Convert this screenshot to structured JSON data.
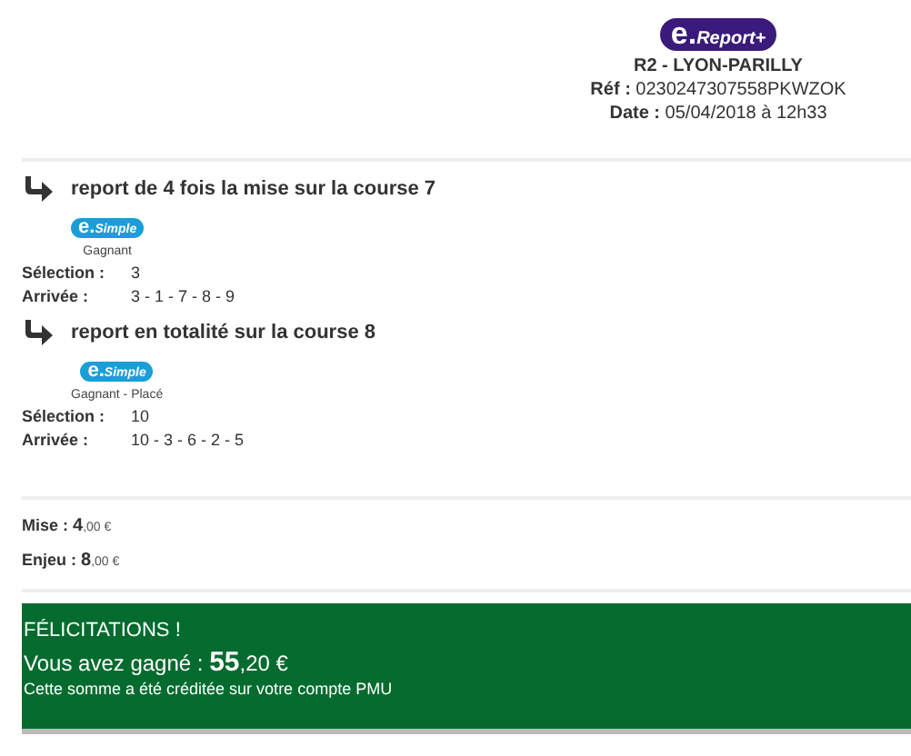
{
  "header": {
    "logo": {
      "mark": "e.",
      "name": "Report+"
    },
    "race": "R2 - LYON-PARILLY",
    "ref_label": "Réf :",
    "ref": "0230247307558PKWZOK",
    "date_label": "Date :",
    "date": "05/04/2018 à 12h33"
  },
  "reports": [
    {
      "title": "report de 4 fois la mise sur la course 7",
      "badge": {
        "mark": "e.",
        "name": "Simple"
      },
      "bet_type": "Gagnant",
      "selection_label": "Sélection :",
      "selection": "3",
      "arrival_label": "Arrivée :",
      "arrival": "3 - 1 - 7 - 8 - 9"
    },
    {
      "title": "report en totalité sur la course 8",
      "badge": {
        "mark": "e.",
        "name": "Simple"
      },
      "bet_type": "Gagnant - Placé",
      "selection_label": "Sélection :",
      "selection": "10",
      "arrival_label": "Arrivée :",
      "arrival": "10 - 3 - 6 - 2 - 5"
    }
  ],
  "amounts": [
    {
      "label": "Mise :",
      "units": "4",
      "cents": ",00 €"
    },
    {
      "label": "Enjeu :",
      "units": "8",
      "cents": ",00 €"
    }
  ],
  "banner": {
    "title": "FÉLICITATIONS !",
    "win_label": "Vous avez gagné :",
    "win_units": "55",
    "win_cents": ",20 €",
    "note": "Cette somme a été créditée sur votre compte PMU"
  }
}
